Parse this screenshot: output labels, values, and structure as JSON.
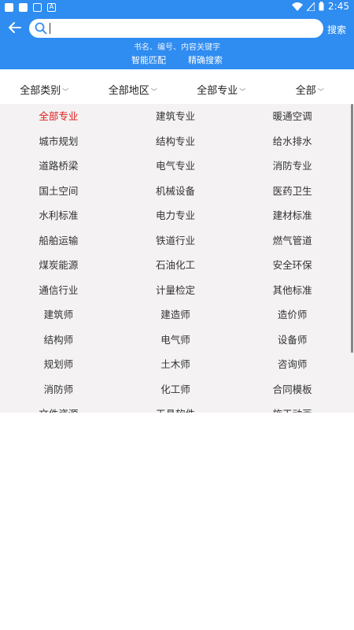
{
  "status_bar": {
    "time": "2:45"
  },
  "search": {
    "value": "",
    "placeholder": "",
    "button_label": "搜索",
    "hint": "书名、编号、内容关键字"
  },
  "modes": [
    "智能匹配",
    "精确搜索"
  ],
  "filters": [
    "全部类别",
    "全部地区",
    "全部专业",
    "全部"
  ],
  "specialties": [
    "全部专业",
    "建筑专业",
    "暖通空调",
    "城市规划",
    "结构专业",
    "给水排水",
    "道路桥梁",
    "电气专业",
    "消防专业",
    "国土空间",
    "机械设备",
    "医药卫生",
    "水利标准",
    "电力专业",
    "建材标准",
    "船舶运输",
    "铁道行业",
    "燃气管道",
    "煤炭能源",
    "石油化工",
    "安全环保",
    "通信行业",
    "计量检定",
    "其他标准",
    "建筑师",
    "建造师",
    "造价师",
    "结构师",
    "电气师",
    "设备师",
    "规划师",
    "土木师",
    "咨询师",
    "消防师",
    "化工师",
    "合同模板",
    "文件资源",
    "工具软件",
    "施工动画"
  ],
  "selected_specialty": "全部专业",
  "colors": {
    "header": "#2f8cf0",
    "active": "#e01b1b",
    "panel": "#f4f2f2"
  }
}
